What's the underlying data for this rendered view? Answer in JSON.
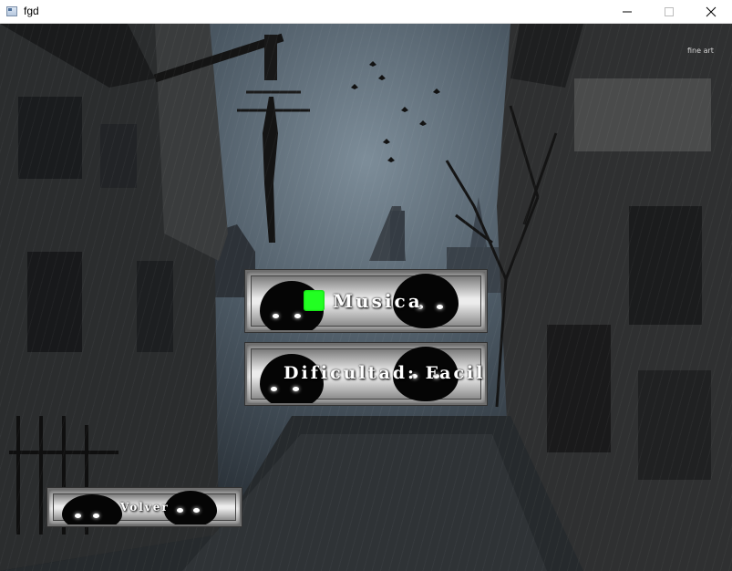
{
  "window": {
    "title": "fgd"
  },
  "watermark": "fine art",
  "menu": {
    "music_label": "Musica",
    "music_enabled": true,
    "difficulty_label": "Dificultad: Facil",
    "back_label": "Volver"
  },
  "colors": {
    "checkbox": "#22ff22",
    "text": "#ffffff"
  }
}
